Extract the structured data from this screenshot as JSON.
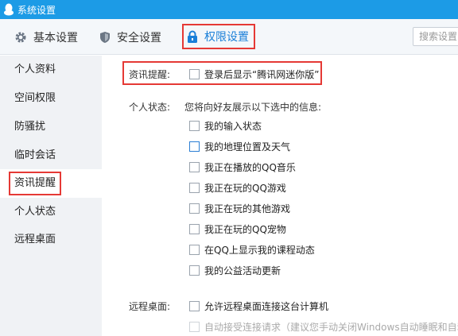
{
  "window": {
    "title": "系统设置"
  },
  "toolbar": {
    "tabs": [
      {
        "label": "基本设置",
        "icon": "gear-icon"
      },
      {
        "label": "安全设置",
        "icon": "shield-icon"
      },
      {
        "label": "权限设置",
        "icon": "lock-icon"
      }
    ],
    "search_placeholder": "搜索设置"
  },
  "sidebar": {
    "items": [
      {
        "label": "个人资料"
      },
      {
        "label": "空间权限"
      },
      {
        "label": "防骚扰"
      },
      {
        "label": "临时会话"
      },
      {
        "label": "资讯提醒"
      },
      {
        "label": "个人状态"
      },
      {
        "label": "远程桌面"
      }
    ],
    "active": "资讯提醒"
  },
  "news": {
    "label": "资讯提醒:",
    "option": "登录后显示“腾讯网迷你版”",
    "checked": false
  },
  "status": {
    "label": "个人状态:",
    "intro": "您将向好友展示以下选中的信息:",
    "options": [
      {
        "label": "我的输入状态",
        "checked": false
      },
      {
        "label": "我的地理位置及天气",
        "checked": false
      },
      {
        "label": "我正在播放的QQ音乐",
        "checked": false
      },
      {
        "label": "我正在玩的QQ游戏",
        "checked": false
      },
      {
        "label": "我正在玩的其他游戏",
        "checked": false
      },
      {
        "label": "我正在玩的QQ宠物",
        "checked": false
      },
      {
        "label": "在QQ上显示我的课程动态",
        "checked": false
      },
      {
        "label": "我的公益活动更新",
        "checked": false
      }
    ]
  },
  "remote": {
    "label": "远程桌面:",
    "allow": "允许远程桌面连接这台计算机",
    "auto_accept": "自动接受连接请求（建议您手动关闭Windows自动睡眠和自动"
  },
  "colors": {
    "accent": "#1c9be6",
    "highlight": "#e53935",
    "sidebar_bg": "#f0f2f5"
  }
}
